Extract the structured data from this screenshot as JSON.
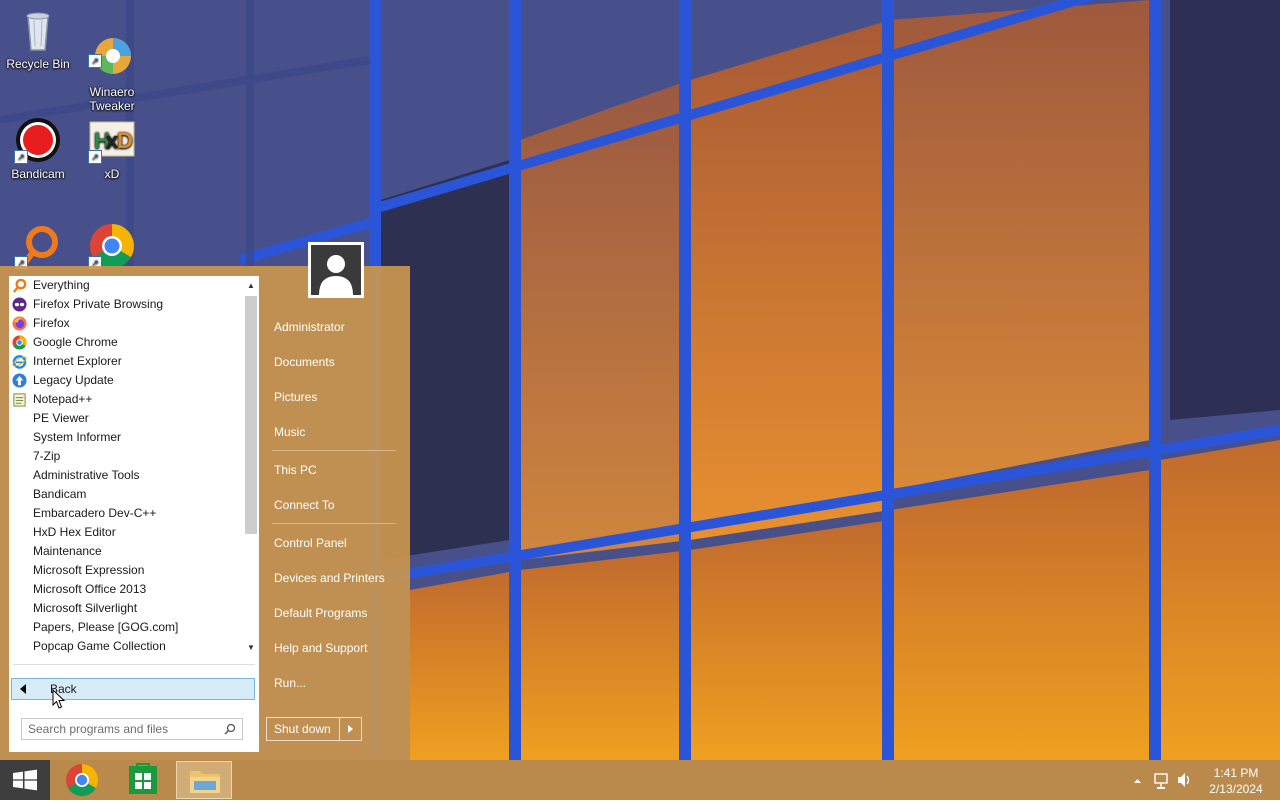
{
  "desktop": {
    "icons": [
      {
        "label": "Recycle Bin",
        "icon": "recycle-bin-icon"
      },
      {
        "label": "Winaero\nTweaker",
        "icon": "winaero-tweaker-icon"
      },
      {
        "label": "Bandicam",
        "icon": "bandicam-icon"
      },
      {
        "label": "xD",
        "icon": "hxd-icon"
      },
      {
        "label": "",
        "icon": "everything-icon"
      },
      {
        "label": "",
        "icon": "chrome-icon"
      }
    ]
  },
  "start_menu": {
    "programs": [
      {
        "label": "Everything",
        "icon": "everything-icon"
      },
      {
        "label": "Firefox Private Browsing",
        "icon": "firefox-private-icon"
      },
      {
        "label": "Firefox",
        "icon": "firefox-icon"
      },
      {
        "label": "Google Chrome",
        "icon": "chrome-icon"
      },
      {
        "label": "Internet Explorer",
        "icon": "ie-icon"
      },
      {
        "label": "Legacy Update",
        "icon": "legacy-update-icon"
      },
      {
        "label": "Notepad++",
        "icon": "notepadpp-icon"
      },
      {
        "label": "PE Viewer",
        "icon": ""
      },
      {
        "label": "System Informer",
        "icon": ""
      },
      {
        "label": "7-Zip",
        "icon": ""
      },
      {
        "label": "Administrative Tools",
        "icon": ""
      },
      {
        "label": "Bandicam",
        "icon": ""
      },
      {
        "label": "Embarcadero Dev-C++",
        "icon": ""
      },
      {
        "label": "HxD Hex Editor",
        "icon": ""
      },
      {
        "label": "Maintenance",
        "icon": ""
      },
      {
        "label": "Microsoft Expression",
        "icon": ""
      },
      {
        "label": "Microsoft Office 2013",
        "icon": ""
      },
      {
        "label": "Microsoft Silverlight",
        "icon": ""
      },
      {
        "label": "Papers, Please [GOG.com]",
        "icon": ""
      },
      {
        "label": "Popcap Game Collection",
        "icon": ""
      }
    ],
    "back_label": "Back",
    "search_placeholder": "Search programs and files",
    "right_items": [
      "Administrator",
      "Documents",
      "Pictures",
      "Music",
      "This PC",
      "Connect To",
      "Control Panel",
      "Devices and Printers",
      "Default Programs",
      "Help and Support",
      "Run..."
    ],
    "shutdown_label": "Shut down"
  },
  "taskbar": {
    "pinned": [
      "chrome-icon",
      "store-icon",
      "file-explorer-icon"
    ],
    "clock_time": "1:41 PM",
    "clock_date": "2/13/2024",
    "tray_icons": [
      "show-hidden-icons",
      "network-icon",
      "volume-icon"
    ]
  },
  "colors": {
    "start_panel": "#c9964e",
    "taskbar": "#b98a4c",
    "back_highlight": "#d8ecf8"
  }
}
